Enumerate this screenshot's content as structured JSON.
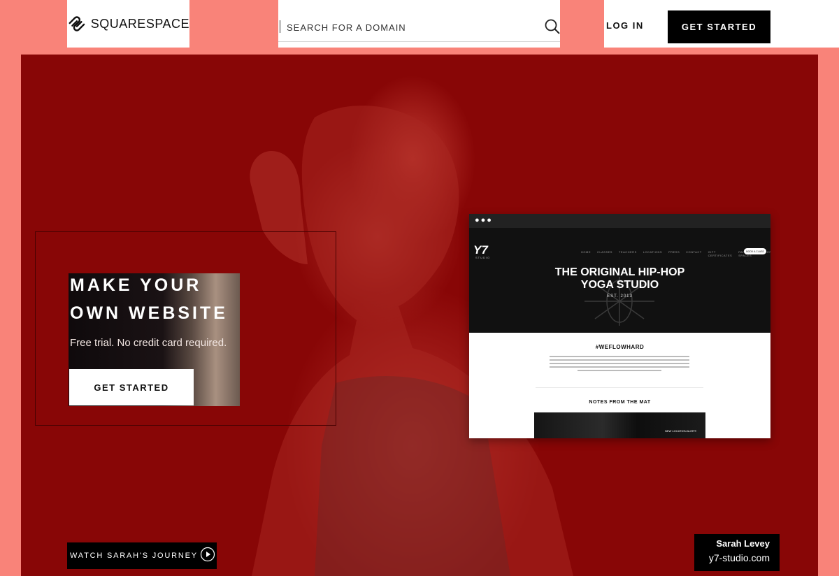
{
  "header": {
    "logo_text": "SQUARESPACE",
    "search": {
      "placeholder": "SEARCH FOR A DOMAIN",
      "value": ""
    },
    "login_label": "LOG IN",
    "cta_label": "GET STARTED"
  },
  "hero": {
    "title_line1": "MAKE YOUR",
    "title_line2": "OWN WEBSITE",
    "subtitle": "Free trial. No credit card required.",
    "cta_label": "GET STARTED",
    "journey_label": "WATCH SARAH'S JOURNEY",
    "credit_name": "Sarah Levey",
    "credit_url": "y7-studio.com"
  },
  "mockup": {
    "browser_dots": "●●●",
    "site_logo": "Y7",
    "site_logo_sub": "STUDIO",
    "nav_items": [
      "HOME",
      "CLASSES",
      "TEACHERS",
      "LOCATIONS",
      "PRESS",
      "CONTACT",
      "GIFT CERTIFICATES",
      "PARTY SPACES",
      "CAREERS"
    ],
    "nav_button": "BOOK A CLASS",
    "headline_line1": "THE ORIGINAL HIP-HOP",
    "headline_line2": "YOGA STUDIO",
    "est": "EST. 2013",
    "tag": "#WEFLOWHARD",
    "notes_heading": "NOTES FROM THE MAT",
    "photo_caption": "NEW LOCATION ALERT!"
  },
  "colors": {
    "page_bg": "#f98379",
    "hero_bg": "#880606",
    "black": "#000000",
    "white": "#ffffff"
  },
  "icons": [
    "squarespace-logo-icon",
    "search-icon",
    "play-icon"
  ]
}
